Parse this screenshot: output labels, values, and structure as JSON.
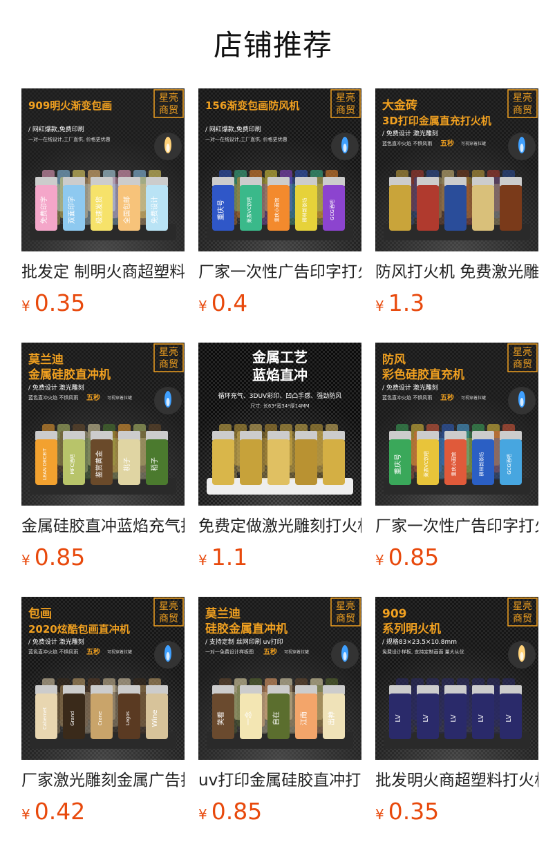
{
  "page": {
    "title": "店铺推荐"
  },
  "products": [
    {
      "name": "批发定 制明火商超塑料打火机",
      "currency": "¥",
      "price": "0.35",
      "badge": [
        "星亮",
        "商贸"
      ],
      "banner": [
        "909明火渐变包画"
      ],
      "subtitle": "/ 网红爆款,免费印刷",
      "tagline": "一对一在线设计,工厂直供, 价格更优惠",
      "item_labels": [
        "免费印字",
        "双面印字",
        "极速发货",
        "全国包邮",
        "免费设计"
      ],
      "theme": {
        "bg": "#1d1d1d",
        "accent": "#f0a020",
        "colors": [
          "#f4a6c9",
          "#8ec9f0",
          "#f6e26a",
          "#f7c37a",
          "#b9e3f5"
        ]
      }
    },
    {
      "name": "厂家一次性广告印字打火机",
      "currency": "¥",
      "price": "0.4",
      "badge": [
        "星亮",
        "商贸"
      ],
      "banner": [
        "156渐变包画防风机"
      ],
      "subtitle": "/ 网红爆款,免费印刷",
      "tagline": "一对一在线设计,工厂直供, 价格更优惠",
      "item_labels": [
        "重庆号",
        "莱茶VC饮吧",
        "重庆小面馆",
        "柳林新茶坊",
        "GCG酒吧"
      ],
      "theme": {
        "bg": "#161616",
        "accent": "#f0a020",
        "colors": [
          "#2f57c8",
          "#3ab98a",
          "#f38a2d",
          "#e6d23a",
          "#8c44cf"
        ]
      }
    },
    {
      "name": "防风打火机 免费激光雕刻",
      "currency": "¥",
      "price": "1.3",
      "badge": [
        "星亮",
        "商贸"
      ],
      "banner": [
        "大金砖",
        "3D打印金属直充打火机"
      ],
      "subtitle": "/ 免费设计 激光雕刻",
      "tagline": "蓝色直冲火焰 不惧风雨",
      "highlight": "五秒",
      "note": "可视穿着拉罐",
      "item_labels": [],
      "theme": {
        "bg": "#1a1a1a",
        "accent": "#f0a020",
        "colors": [
          "#c9a43a",
          "#b03a2e",
          "#2a4d9a",
          "#d9c07a",
          "#7a3a1a"
        ]
      }
    },
    {
      "name": "金属硅胶直冲蓝焰充气打火机",
      "currency": "¥",
      "price": "0.85",
      "badge": [
        "星亮",
        "商贸"
      ],
      "banner": [
        "莫兰迪",
        "金属硅胶直冲机"
      ],
      "subtitle": "/ 免费设计 激光雕刻",
      "tagline": "蓝色直冲火焰 不惧风雨",
      "highlight": "五秒",
      "note": "可视穿着拉罐",
      "item_labels": [
        "LEAN DECEIT",
        "MFC酒吧",
        "鉴赏黄金",
        "桃子",
        "稻子"
      ],
      "theme": {
        "bg": "#1a1a1a",
        "accent": "#f0a020",
        "colors": [
          "#f2a12f",
          "#b8c46a",
          "#6a4a2a",
          "#e0d5a3",
          "#4b7a2e"
        ]
      }
    },
    {
      "name": "免费定做激光雕刻打火机",
      "currency": "¥",
      "price": "1.1",
      "badge": [],
      "banner": [
        "金属工艺",
        "蓝焰直冲"
      ],
      "subtitle": "循环充气、3DUV彩印、凹凸手感、强劲防风",
      "tagline": "尺寸: 长63*宽34*厚14MM",
      "item_labels": [],
      "theme": {
        "bg": "#0b0b0b",
        "accent": "#ffd24a",
        "colors": [
          "#d9b64a",
          "#c7a23a",
          "#e0c062",
          "#b99232",
          "#d4af44"
        ]
      }
    },
    {
      "name": "厂家一次性广告印字打火机",
      "currency": "¥",
      "price": "0.85",
      "badge": [
        "星亮",
        "商贸"
      ],
      "banner": [
        "防风",
        "彩色硅胶直充机"
      ],
      "subtitle": "/ 免费设计 激光雕刻",
      "tagline": "蓝色直冲火焰 不惧风雨",
      "highlight": "五秒",
      "note": "可视穿着拉罐",
      "item_labels": [
        "重庆号",
        "莱茶VC饮吧",
        "重庆小面馆",
        "柳林新茶坊",
        "GCG酒吧"
      ],
      "theme": {
        "bg": "#1a1a1a",
        "accent": "#f0a020",
        "colors": [
          "#3aa85a",
          "#e8c43a",
          "#e05a3a",
          "#2b5fc4",
          "#47a6e0"
        ]
      }
    },
    {
      "name": "厂家激光雕刻金属广告打火机",
      "currency": "¥",
      "price": "0.42",
      "badge": [
        "星亮",
        "商贸"
      ],
      "banner": [
        "包画",
        "2020炫酷包画直冲机"
      ],
      "subtitle": "/ 免费设计 激光雕刻",
      "tagline": "蓝色直冲火焰 不惧风雨",
      "highlight": "五秒",
      "note": "可视穿着拉罐",
      "item_labels": [
        "Cabernet",
        "Grand",
        "Crane",
        "Lagos",
        "Wine"
      ],
      "theme": {
        "bg": "#161616",
        "accent": "#f0a020",
        "colors": [
          "#e8d6b0",
          "#3a2a1a",
          "#c9a46a",
          "#5a3a22",
          "#d7c39a"
        ]
      }
    },
    {
      "name": "uv打印金属硅胶直冲打火机",
      "currency": "¥",
      "price": "0.85",
      "badge": [
        "星亮",
        "商贸"
      ],
      "banner": [
        "莫兰迪",
        "硅胶金属直冲机"
      ],
      "subtitle": "/ 支持定制 丝网印刷 uv打印",
      "tagline": "一对一免费设计样板图",
      "highlight": "五秒",
      "note": "可视穿着拉罐",
      "item_labels": [
        "笑看",
        "一念",
        "自在",
        "江南",
        "出神"
      ],
      "theme": {
        "bg": "#1a1a1a",
        "accent": "#f0a020",
        "colors": [
          "#6a4a2e",
          "#f3e6b3",
          "#5b6e2e",
          "#f3a56a",
          "#efe2b8"
        ]
      }
    },
    {
      "name": "批发明火商超塑料打火机",
      "currency": "¥",
      "price": "0.35",
      "badge": [
        "星亮",
        "商贸"
      ],
      "banner": [
        "909",
        "系列明火机"
      ],
      "subtitle": "/ 规格83×23.5×10.8mm",
      "tagline": "免费设计样板, 支持定制画面 量大从优",
      "item_labels": [
        "LV",
        "LV",
        "LV",
        "LV",
        "LV"
      ],
      "theme": {
        "bg": "#161616",
        "accent": "#f0a020",
        "colors": [
          "#2a2a6a",
          "#2a2a6a",
          "#2a2a6a",
          "#2a2a6a",
          "#2a2a6a"
        ]
      }
    }
  ]
}
